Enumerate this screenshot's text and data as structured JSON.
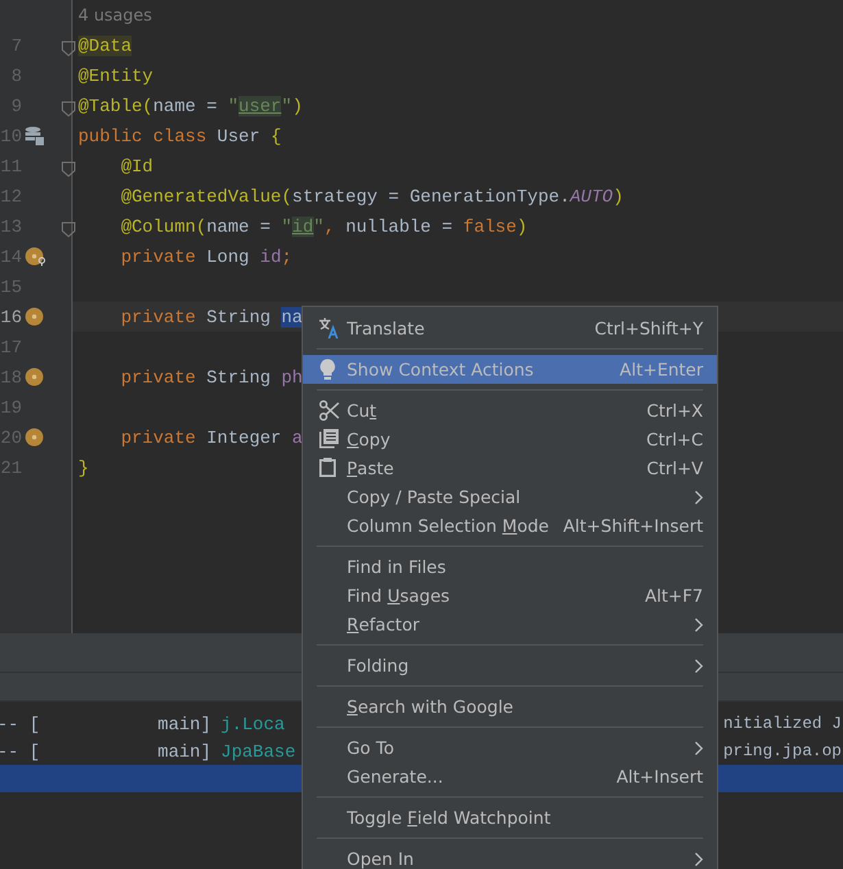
{
  "editor": {
    "usages_hint": "4 usages",
    "lines": [
      {
        "number": "7",
        "current": false,
        "tokens": [
          {
            "kind": "annotation_hl",
            "text": "@Data"
          }
        ]
      },
      {
        "number": "8",
        "current": false,
        "tokens": [
          {
            "kind": "annotation",
            "text": "@Entity"
          }
        ]
      },
      {
        "number": "9",
        "current": false,
        "tokens": [
          {
            "kind": "annotation",
            "text": "@Table("
          },
          {
            "kind": "plain",
            "text": "name = "
          },
          {
            "kind": "string",
            "text": "\""
          },
          {
            "kind": "ref",
            "text": "user"
          },
          {
            "kind": "string",
            "text": "\""
          },
          {
            "kind": "annotation",
            "text": ")"
          }
        ]
      },
      {
        "number": "10",
        "current": false,
        "tokens": [
          {
            "kind": "keyword",
            "text": "public class "
          },
          {
            "kind": "plain",
            "text": "User "
          },
          {
            "kind": "annotation",
            "text": "{"
          }
        ]
      },
      {
        "number": "11",
        "current": false,
        "tokens": [
          {
            "kind": "annotation",
            "text": "    @Id"
          }
        ]
      },
      {
        "number": "12",
        "current": false,
        "tokens": [
          {
            "kind": "annotation",
            "text": "    @GeneratedValue("
          },
          {
            "kind": "plain",
            "text": "strategy = GenerationType."
          },
          {
            "kind": "constant",
            "text": "AUTO"
          },
          {
            "kind": "annotation",
            "text": ")"
          }
        ]
      },
      {
        "number": "13",
        "current": false,
        "tokens": [
          {
            "kind": "annotation",
            "text": "    @Column("
          },
          {
            "kind": "plain",
            "text": "name = "
          },
          {
            "kind": "string",
            "text": "\""
          },
          {
            "kind": "ref",
            "text": "id"
          },
          {
            "kind": "string",
            "text": "\""
          },
          {
            "kind": "keyword",
            "text": ", "
          },
          {
            "kind": "plain",
            "text": "nullable = "
          },
          {
            "kind": "keyword",
            "text": "false"
          },
          {
            "kind": "annotation",
            "text": ")"
          }
        ]
      },
      {
        "number": "14",
        "current": false,
        "tokens": [
          {
            "kind": "keyword",
            "text": "    private "
          },
          {
            "kind": "plain",
            "text": "Long "
          },
          {
            "kind": "field",
            "text": "id"
          },
          {
            "kind": "keyword",
            "text": ";"
          }
        ]
      },
      {
        "number": "15",
        "current": false
      },
      {
        "number": "16",
        "current": true,
        "tokens": [
          {
            "kind": "keyword",
            "text": "    private "
          },
          {
            "kind": "plain",
            "text": "String "
          },
          {
            "kind": "selection",
            "text": "na"
          }
        ]
      },
      {
        "number": "17",
        "current": false
      },
      {
        "number": "18",
        "current": false,
        "tokens": [
          {
            "kind": "keyword",
            "text": "    private "
          },
          {
            "kind": "plain",
            "text": "String "
          },
          {
            "kind": "field",
            "text": "ph"
          }
        ]
      },
      {
        "number": "19",
        "current": false
      },
      {
        "number": "20",
        "current": false,
        "tokens": [
          {
            "kind": "keyword",
            "text": "    private "
          },
          {
            "kind": "plain",
            "text": "Integer "
          },
          {
            "kind": "field",
            "text": "a"
          }
        ]
      },
      {
        "number": "21",
        "current": false,
        "tokens": [
          {
            "kind": "annotation",
            "text": "}"
          }
        ]
      }
    ]
  },
  "console": {
    "rows": [
      {
        "selected": false,
        "prefix": "-- [           main]",
        "logger": "j.Loca",
        "message": "nitialized J"
      },
      {
        "selected": false,
        "prefix": "-- [           main]",
        "logger": "JpaBase",
        "message": "pring.jpa.op"
      },
      {
        "selected": true
      }
    ]
  },
  "context_menu": {
    "groups": [
      [
        {
          "label": [
            {
              "text": "Translate",
              "mnemonic": false
            }
          ],
          "shortcut": "Ctrl+Shift+Y",
          "submenu": false,
          "selected": false
        }
      ],
      [
        {
          "label": [
            {
              "text": "Show Context Actions",
              "mnemonic": false
            }
          ],
          "shortcut": "Alt+Enter",
          "submenu": false,
          "selected": true
        }
      ],
      [
        {
          "label": [
            {
              "text": "Cu",
              "mnemonic": false
            },
            {
              "text": "t",
              "mnemonic": true
            }
          ],
          "shortcut": "Ctrl+X",
          "submenu": false,
          "selected": false
        },
        {
          "label": [
            {
              "text": "C",
              "mnemonic": true
            },
            {
              "text": "opy",
              "mnemonic": false
            }
          ],
          "shortcut": "Ctrl+C",
          "submenu": false,
          "selected": false
        },
        {
          "label": [
            {
              "text": "P",
              "mnemonic": true
            },
            {
              "text": "aste",
              "mnemonic": false
            }
          ],
          "shortcut": "Ctrl+V",
          "submenu": false,
          "selected": false
        },
        {
          "label": [
            {
              "text": "Copy / Paste Special",
              "mnemonic": false
            }
          ],
          "submenu": true,
          "selected": false
        },
        {
          "label": [
            {
              "text": "Column Selection ",
              "mnemonic": false
            },
            {
              "text": "M",
              "mnemonic": true
            },
            {
              "text": "ode",
              "mnemonic": false
            }
          ],
          "shortcut": "Alt+Shift+Insert",
          "submenu": false,
          "selected": false
        }
      ],
      [
        {
          "label": [
            {
              "text": "Find in Files",
              "mnemonic": false
            }
          ],
          "submenu": false,
          "selected": false
        },
        {
          "label": [
            {
              "text": "Find ",
              "mnemonic": false
            },
            {
              "text": "U",
              "mnemonic": true
            },
            {
              "text": "sages",
              "mnemonic": false
            }
          ],
          "shortcut": "Alt+F7",
          "submenu": false,
          "selected": false
        },
        {
          "label": [
            {
              "text": "R",
              "mnemonic": true
            },
            {
              "text": "efactor",
              "mnemonic": false
            }
          ],
          "submenu": true,
          "selected": false
        }
      ],
      [
        {
          "label": [
            {
              "text": "Folding",
              "mnemonic": false
            }
          ],
          "submenu": true,
          "selected": false
        }
      ],
      [
        {
          "label": [
            {
              "text": "S",
              "mnemonic": true
            },
            {
              "text": "earch with Google",
              "mnemonic": false
            }
          ],
          "submenu": false,
          "selected": false
        }
      ],
      [
        {
          "label": [
            {
              "text": "Go To",
              "mnemonic": false
            }
          ],
          "submenu": true,
          "selected": false
        },
        {
          "label": [
            {
              "text": "Generate...",
              "mnemonic": false
            }
          ],
          "shortcut": "Alt+Insert",
          "submenu": false,
          "selected": false
        }
      ],
      [
        {
          "label": [
            {
              "text": "Toggle ",
              "mnemonic": false
            },
            {
              "text": "F",
              "mnemonic": true
            },
            {
              "text": "ield Watchpoint",
              "mnemonic": false
            }
          ],
          "submenu": false,
          "selected": false
        }
      ],
      [
        {
          "label": [
            {
              "text": "Open In",
              "mnemonic": false
            }
          ],
          "submenu": true,
          "selected": false
        }
      ]
    ]
  }
}
